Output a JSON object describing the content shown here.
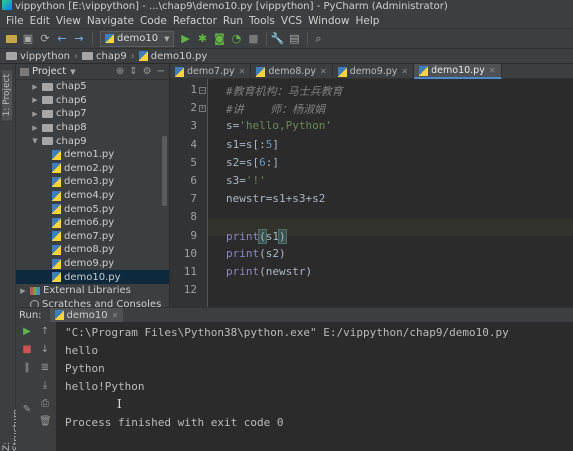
{
  "window": {
    "title": "vippython [E:\\vippython] - ...\\chap9\\demo10.py [vippython] - PyCharm (Administrator)"
  },
  "menu": [
    "File",
    "Edit",
    "View",
    "Navigate",
    "Code",
    "Refactor",
    "Run",
    "Tools",
    "VCS",
    "Window",
    "Help"
  ],
  "toolbar": {
    "run_config": "demo10",
    "icons": [
      "open-icon",
      "save-icon",
      "sync-icon",
      "back-icon",
      "forward-icon",
      "run-icon",
      "debug-icon",
      "coverage-icon",
      "profile-icon",
      "stop-icon",
      "settings-icon",
      "structure-icon",
      "search-icon"
    ]
  },
  "breadcrumb": [
    "vippython",
    "chap9",
    "demo10.py"
  ],
  "side_strip": {
    "project_label": "1: Project",
    "structure_label": "Z: Structure"
  },
  "project_panel": {
    "title": "Project",
    "tree": [
      {
        "label": "chap5",
        "type": "folder",
        "level": 1,
        "expanded": false
      },
      {
        "label": "chap6",
        "type": "folder",
        "level": 1,
        "expanded": false
      },
      {
        "label": "chap7",
        "type": "folder",
        "level": 1,
        "expanded": false
      },
      {
        "label": "chap8",
        "type": "folder",
        "level": 1,
        "expanded": false
      },
      {
        "label": "chap9",
        "type": "folder",
        "level": 1,
        "expanded": true
      },
      {
        "label": "demo1.py",
        "type": "py",
        "level": 2
      },
      {
        "label": "demo2.py",
        "type": "py",
        "level": 2
      },
      {
        "label": "demo3.py",
        "type": "py",
        "level": 2
      },
      {
        "label": "demo4.py",
        "type": "py",
        "level": 2
      },
      {
        "label": "demo5.py",
        "type": "py",
        "level": 2
      },
      {
        "label": "demo6.py",
        "type": "py",
        "level": 2
      },
      {
        "label": "demo7.py",
        "type": "py",
        "level": 2
      },
      {
        "label": "demo8.py",
        "type": "py",
        "level": 2
      },
      {
        "label": "demo9.py",
        "type": "py",
        "level": 2
      },
      {
        "label": "demo10.py",
        "type": "py",
        "level": 2,
        "selected": true
      },
      {
        "label": "External Libraries",
        "type": "lib",
        "level": 0,
        "expanded": false
      },
      {
        "label": "Scratches and Consoles",
        "type": "scratch",
        "level": 0
      }
    ]
  },
  "editor_tabs": [
    {
      "label": "demo7.py",
      "active": false
    },
    {
      "label": "demo8.py",
      "active": false
    },
    {
      "label": "demo9.py",
      "active": false
    },
    {
      "label": "demo10.py",
      "active": true
    }
  ],
  "code_lines": [
    {
      "n": "1",
      "text": "#教育机构：马士兵教育"
    },
    {
      "n": "2",
      "text": "#讲    师：杨淑娟"
    },
    {
      "n": "3",
      "text": "s='hello,Python'"
    },
    {
      "n": "4",
      "text": "s1=s[:5]"
    },
    {
      "n": "5",
      "text": "s2=s[6:]"
    },
    {
      "n": "6",
      "text": "s3='!'"
    },
    {
      "n": "7",
      "text": "newstr=s1+s3+s2"
    },
    {
      "n": "8",
      "text": ""
    },
    {
      "n": "9",
      "text": "print(s1)"
    },
    {
      "n": "10",
      "text": "print(s2)"
    },
    {
      "n": "11",
      "text": "print(newstr)"
    },
    {
      "n": "12",
      "text": ""
    }
  ],
  "run_panel": {
    "label": "Run:",
    "tab": "demo10",
    "output": [
      "\"C:\\Program Files\\Python38\\python.exe\" E:/vippython/chap9/demo10.py",
      "hello",
      "Python",
      "hello!Python",
      "",
      "Process finished with exit code 0"
    ]
  },
  "colors": {
    "background": "#2b2b2b",
    "panel": "#3c3f41",
    "string": "#6a8759",
    "number": "#6897bb",
    "builtin": "#8888c6",
    "selection": "#0d293e",
    "accent": "#4a88c7"
  }
}
